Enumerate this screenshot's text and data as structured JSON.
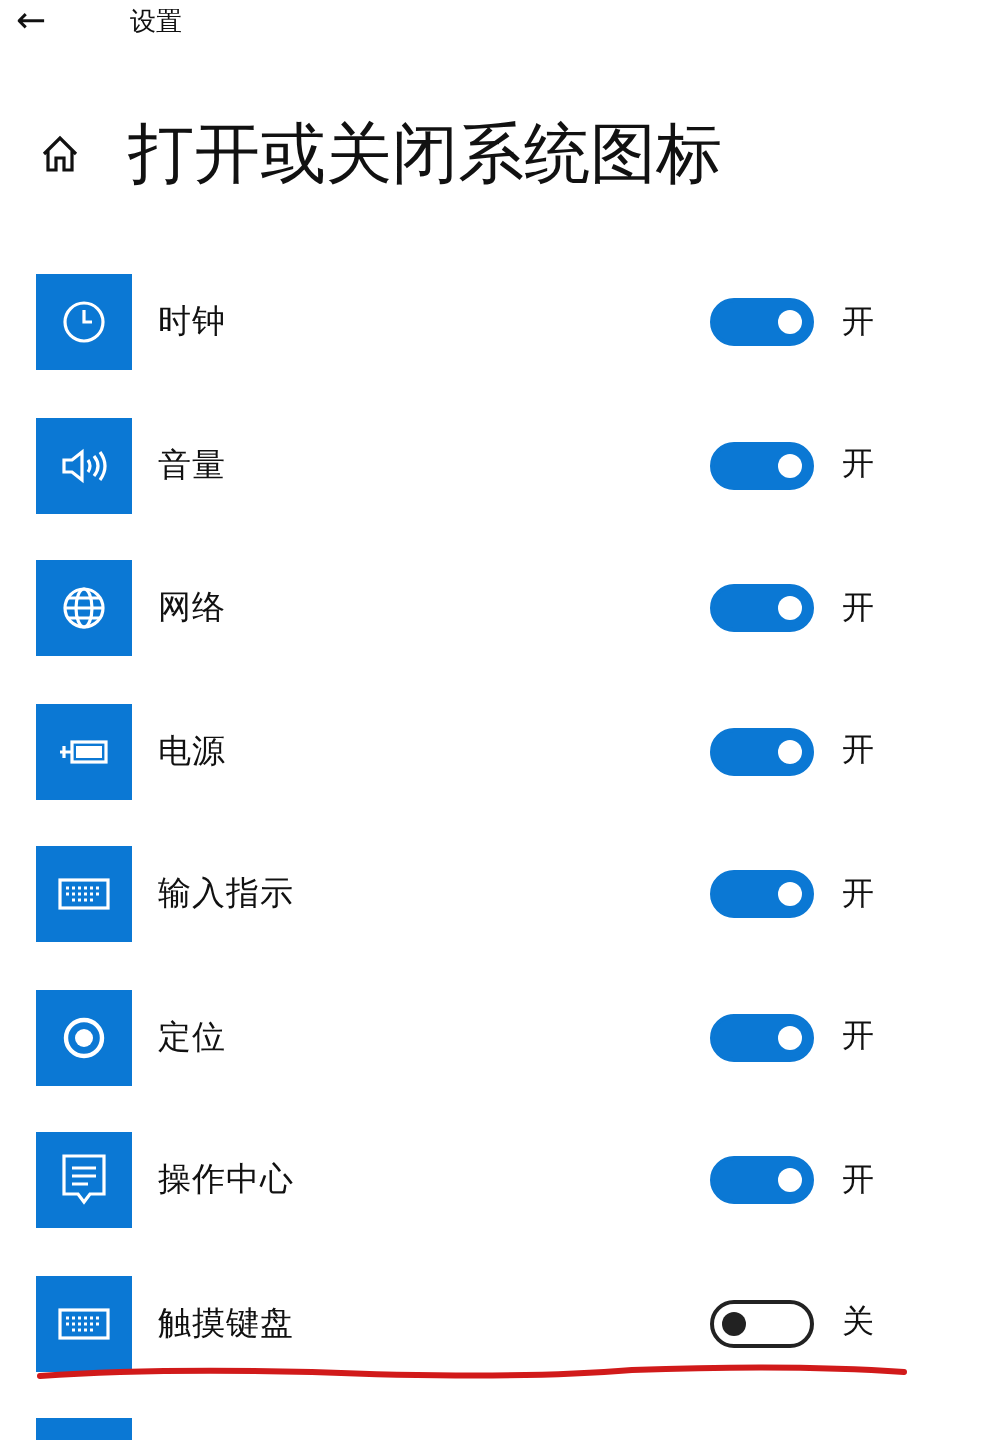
{
  "header": {
    "back": "←",
    "app_title": "设置"
  },
  "page_title": "打开或关闭系统图标",
  "items": [
    {
      "kind": "clock",
      "label": "时钟",
      "on": true,
      "state": "开"
    },
    {
      "kind": "volume",
      "label": "音量",
      "on": true,
      "state": "开"
    },
    {
      "kind": "globe",
      "label": "网络",
      "on": true,
      "state": "开"
    },
    {
      "kind": "power",
      "label": "电源",
      "on": true,
      "state": "开"
    },
    {
      "kind": "keyboard",
      "label": "输入指示",
      "on": true,
      "state": "开"
    },
    {
      "kind": "location",
      "label": "定位",
      "on": true,
      "state": "开"
    },
    {
      "kind": "message",
      "label": "操作中心",
      "on": true,
      "state": "开"
    },
    {
      "kind": "keyboard",
      "label": "触摸键盘",
      "on": false,
      "state": "关"
    }
  ]
}
